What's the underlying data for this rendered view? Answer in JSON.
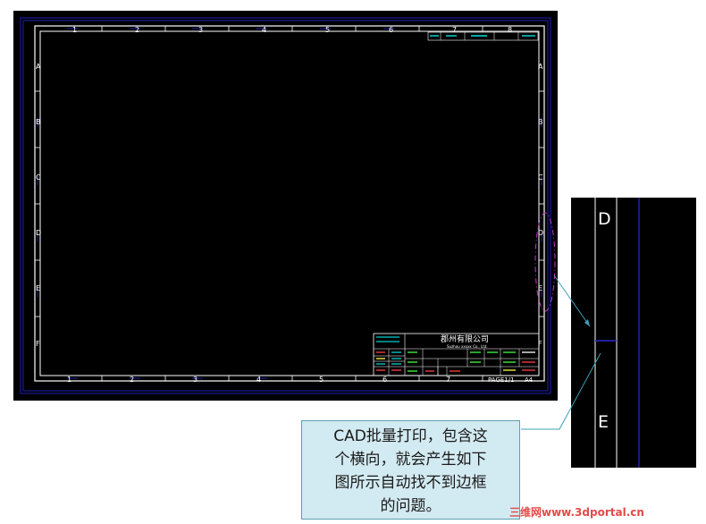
{
  "drawing": {
    "column_labels_top": [
      "1",
      "2",
      "3",
      "4",
      "5",
      "6",
      "7",
      "8"
    ],
    "column_labels_bottom": [
      "1",
      "2",
      "3",
      "4",
      "5",
      "6",
      "7"
    ],
    "row_labels_left": [
      "A",
      "B",
      "C",
      "D",
      "E",
      "F"
    ],
    "row_labels_right": [
      "A",
      "B",
      "C",
      "D",
      "E",
      "F"
    ],
    "title_block": {
      "company_name": "郡州有限公司",
      "company_name_en": "Suzhou xxxxx Co., Ltd.",
      "page": "PAGE1/1",
      "sheet_size": "A4"
    }
  },
  "zoom_inset": {
    "upper_label": "D",
    "lower_label": "E"
  },
  "callout": {
    "lines": [
      "CAD批量打印，包含这",
      "个横向，就会产生如下",
      "图所示自动找不到边框",
      "的问题。"
    ]
  },
  "watermark": "三维网www.3dportal.cn",
  "colors": {
    "canvas": "#000000",
    "border": "#ffffff",
    "outer_frame": "#1f1fb8",
    "highlight_ellipse": "#cc33cc",
    "callout_fill": "#d2eaf1",
    "callout_line": "#3aa0b8",
    "watermark": "#e34a4a"
  }
}
